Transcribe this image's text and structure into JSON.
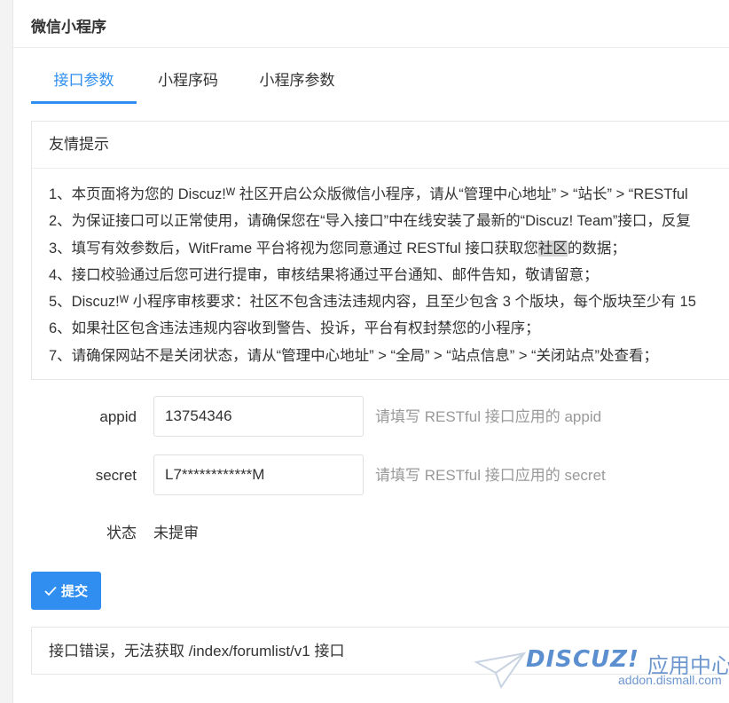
{
  "panel": {
    "title": "微信小程序"
  },
  "tabs": [
    {
      "label": "接口参数",
      "active": true
    },
    {
      "label": "小程序码",
      "active": false
    },
    {
      "label": "小程序参数",
      "active": false
    }
  ],
  "notice": {
    "title": "友情提示",
    "items": [
      {
        "pre": "1、本页面将为您的 Discuz!ᵂ 社区开启公众版微信小程序，请从“管理中心地址” > “站长” > “RESTful"
      },
      {
        "pre": "2、为保证接口可以正常使用，请确保您在“导入接口”中在线安装了最新的“Discuz! Team”接口，反复"
      },
      {
        "pre": "3、填写有效参数后，WitFrame 平台将视为您同意通过 RESTful 接口获取您",
        "highlight": "社区",
        "post": "的数据；"
      },
      {
        "pre": "4、接口校验通过后您可进行提审，审核结果将通过平台通知、邮件告知，敬请留意；"
      },
      {
        "pre": "5、Discuz!ᵂ 小程序审核要求：社区不包含违法违规内容，且至少包含 3 个版块，每个版块至少有 15"
      },
      {
        "pre": "6、如果社区包含违法违规内容收到警告、投诉，平台有权封禁您的小程序；"
      },
      {
        "pre": "7、请确保网站不是关闭状态，请从“管理中心地址” > “全局” > “站点信息” > “关闭站点”处查看；"
      }
    ]
  },
  "form": {
    "appid": {
      "label": "appid",
      "value": "13754346",
      "hint": "请填写 RESTful 接口应用的 appid"
    },
    "secret": {
      "label": "secret",
      "value": "L7************M",
      "hint": "请填写 RESTful 接口应用的 secret"
    },
    "status": {
      "label": "状态",
      "value": "未提审"
    }
  },
  "submit": {
    "icon": "check-icon",
    "label": "提交"
  },
  "error": {
    "text": "接口错误，无法获取 /index/forumlist/v1 接口"
  },
  "watermark": {
    "logo": "DISCUZ!",
    "cn": "应用中心",
    "url": "addon.dismall.com"
  },
  "colors": {
    "accent": "#2f8ef0",
    "hint": "#999999",
    "border": "#e6e6e6"
  }
}
